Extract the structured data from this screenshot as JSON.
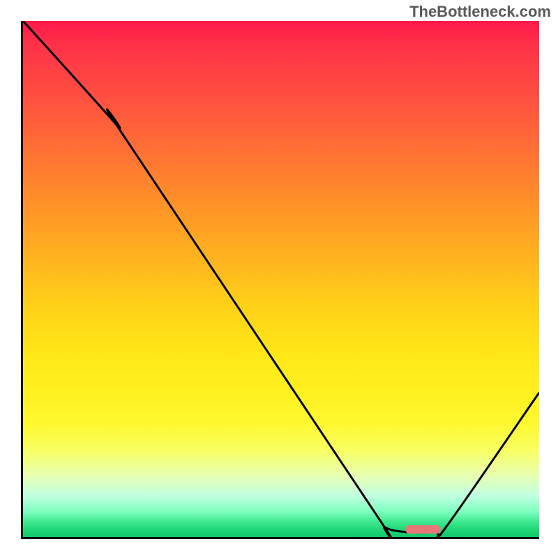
{
  "watermark": "TheBottleneck.com",
  "chart_data": {
    "type": "line",
    "title": "",
    "xlabel": "",
    "ylabel": "",
    "xlim": [
      0,
      100
    ],
    "ylim": [
      0,
      100
    ],
    "curve": [
      {
        "x": 0,
        "y": 100
      },
      {
        "x": 18,
        "y": 80
      },
      {
        "x": 20,
        "y": 77
      },
      {
        "x": 68,
        "y": 5
      },
      {
        "x": 70,
        "y": 2
      },
      {
        "x": 74,
        "y": 1
      },
      {
        "x": 80,
        "y": 1
      },
      {
        "x": 82,
        "y": 2
      },
      {
        "x": 100,
        "y": 28
      }
    ],
    "marker": {
      "x_start": 74,
      "x_end": 81,
      "y": 1.5,
      "color": "#e87878"
    },
    "background": "vertical-gradient-red-to-green"
  }
}
